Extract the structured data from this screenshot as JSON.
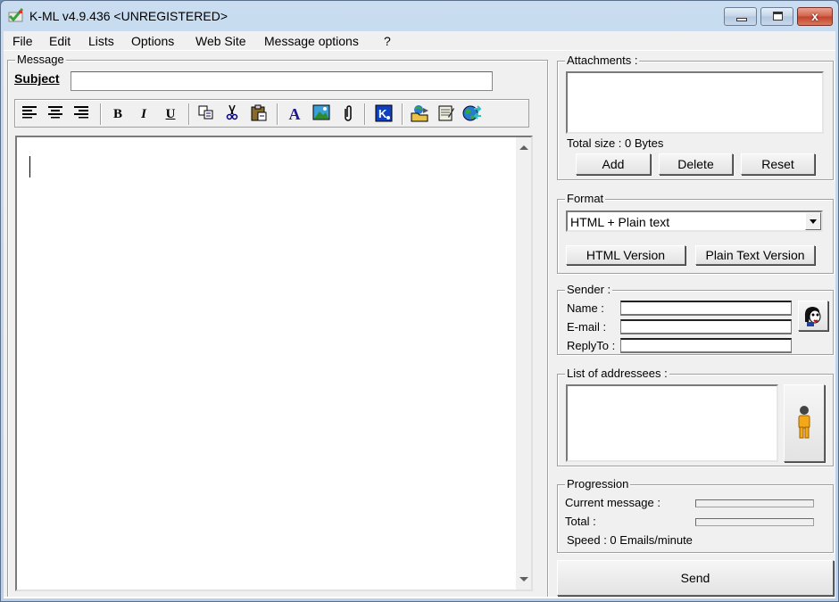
{
  "window": {
    "title": "K-ML v4.9.436 <UNREGISTERED>",
    "minimize_icon": "minimize-icon",
    "maximize_icon": "restore-icon",
    "close_glyph": "x"
  },
  "menu": {
    "items": [
      {
        "label": "File"
      },
      {
        "label": "Edit"
      },
      {
        "label": "Lists"
      },
      {
        "label": "Options"
      },
      {
        "label": "Web Site"
      },
      {
        "label": "Message options"
      },
      {
        "label": "?"
      }
    ]
  },
  "message": {
    "group_label": "Message",
    "subject_label": "Subject",
    "subject_value": "",
    "body_value": "",
    "toolbar": {
      "align_left": "align-left-icon",
      "align_center": "align-center-icon",
      "align_right": "align-right-icon",
      "bold": "B",
      "italic": "I",
      "underline": "U",
      "copy": "copy-icon",
      "cut": "cut-icon",
      "paste": "paste-icon",
      "font": "A",
      "image": "insert-image-icon",
      "attach": "paperclip-icon",
      "kml": "K",
      "open": "open-folder-icon",
      "notes": "notepad-icon",
      "web": "globe-icon"
    }
  },
  "attachments": {
    "group_label": "Attachments :",
    "total_size": "Total size : 0 Bytes",
    "add_label": "Add",
    "delete_label": "Delete",
    "reset_label": "Reset"
  },
  "format": {
    "group_label": "Format",
    "selected": "HTML + Plain text",
    "html_version_label": "HTML Version",
    "plain_version_label": "Plain Text Version"
  },
  "sender": {
    "group_label": "Sender :",
    "name_label": "Name :",
    "email_label": "E-mail :",
    "replyto_label": "ReplyTo :",
    "name_value": "",
    "email_value": "",
    "replyto_value": ""
  },
  "addressees": {
    "group_label": "List of addressees :"
  },
  "progression": {
    "group_label": "Progression",
    "current_label": "Current message :",
    "total_label": "Total :",
    "current_progress": 0,
    "total_progress": 0,
    "speed": "Speed : 0 Emails/minute"
  },
  "send_label": "Send",
  "colors": {
    "titlebar": "#c9dcf0",
    "close_button": "#c2432a",
    "dialog_bg": "#f0f0f0"
  }
}
